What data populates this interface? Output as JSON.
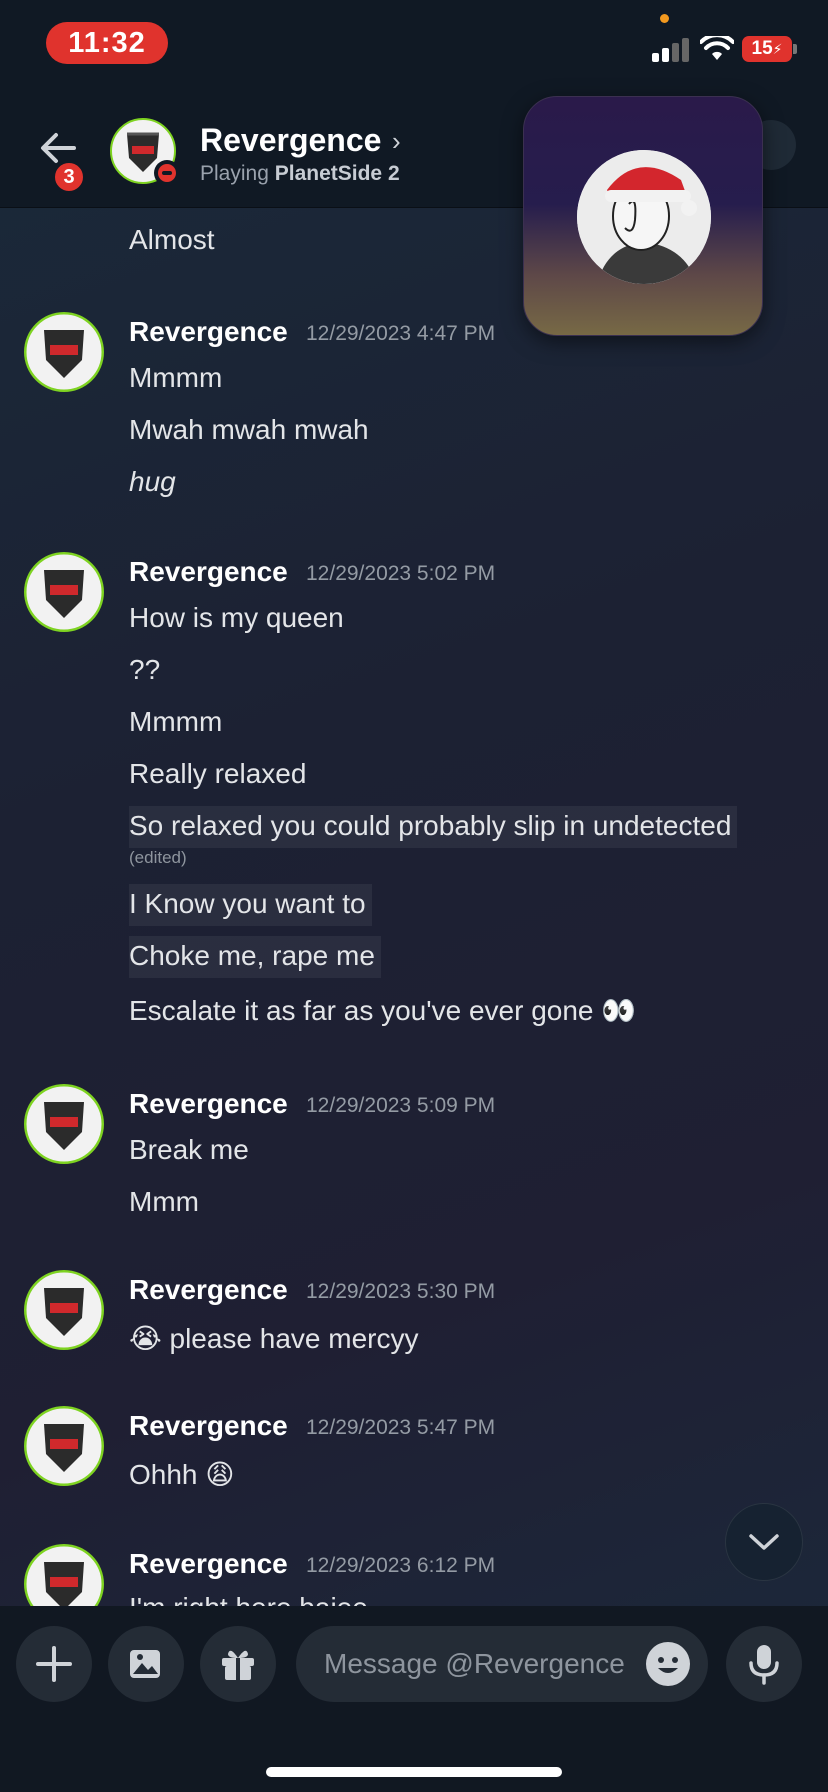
{
  "status_bar": {
    "time": "11:32",
    "battery": "15"
  },
  "header": {
    "back_badge": "3",
    "name": "Revergence",
    "chevron": "›",
    "activity_prefix": "Playing",
    "activity_game": "PlanetSide 2"
  },
  "messages": {
    "top_line": "Almost",
    "groups": [
      {
        "author": "Revergence",
        "timestamp": "12/29/2023 4:47 PM",
        "lines": [
          "Mmmm",
          "Mwah mwah mwah",
          "hug"
        ]
      },
      {
        "author": "Revergence",
        "timestamp": "12/29/2023 5:02 PM",
        "lines": [
          "How is my queen",
          "??",
          "Mmmm",
          "Really relaxed",
          "So relaxed you could probably slip in undetected",
          "I Know you want to",
          "Choke me, rape me",
          "Escalate it as far as you've ever gone 👀"
        ],
        "edited": "(edited)"
      },
      {
        "author": "Revergence",
        "timestamp": "12/29/2023 5:09 PM",
        "lines": [
          "Break me",
          "Mmm"
        ]
      },
      {
        "author": "Revergence",
        "timestamp": "12/29/2023 5:30 PM",
        "lines": [
          "😭 please have mercyy"
        ]
      },
      {
        "author": "Revergence",
        "timestamp": "12/29/2023 5:47 PM",
        "lines": [
          "Ohhh 😩"
        ]
      },
      {
        "author": "Revergence",
        "timestamp": "12/29/2023 6:12 PM",
        "lines": [
          "I'm right here baiee"
        ]
      }
    ]
  },
  "composer": {
    "placeholder": "Message @Revergence"
  },
  "colors": {
    "accent_red": "#e0332d",
    "online_green": "#7ed321"
  }
}
